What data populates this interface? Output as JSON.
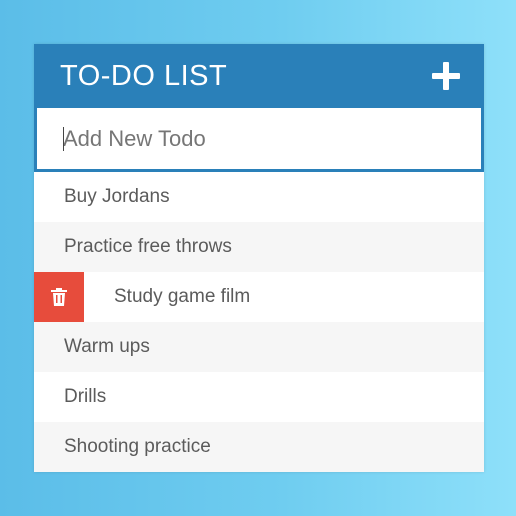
{
  "header": {
    "title": "TO-DO LIST",
    "add_icon": "plus-icon"
  },
  "input": {
    "placeholder": "Add New Todo",
    "value": ""
  },
  "todos": [
    {
      "text": "Buy Jordans",
      "hovered": false
    },
    {
      "text": "Practice free throws",
      "hovered": false
    },
    {
      "text": "Study game film",
      "hovered": true
    },
    {
      "text": "Warm ups",
      "hovered": false
    },
    {
      "text": "Drills",
      "hovered": false
    },
    {
      "text": "Shooting practice",
      "hovered": false
    }
  ],
  "delete_icon": "trash-icon",
  "colors": {
    "header": "#2a80b9",
    "delete": "#e74c3c",
    "alt_row": "#f6f6f6",
    "text": "#5b5b5b"
  }
}
